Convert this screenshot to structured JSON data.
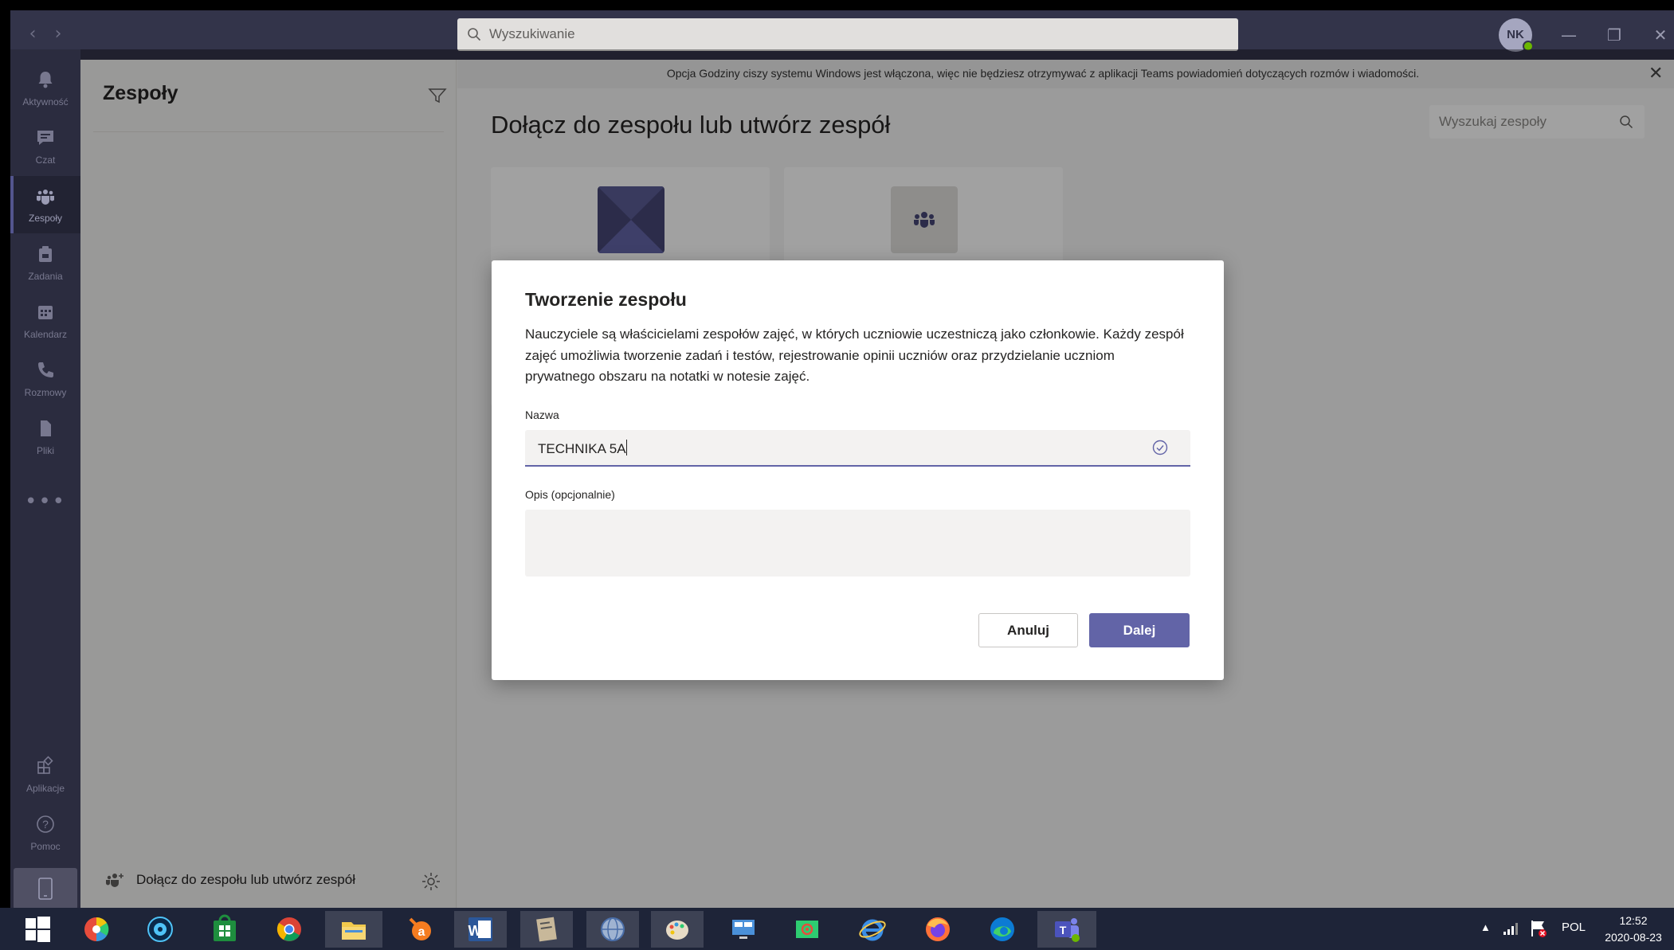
{
  "titlebar": {
    "search_placeholder": "Wyszukiwanie",
    "avatar_initials": "NK",
    "minimize": "—",
    "restore": "❐",
    "close": "✕"
  },
  "rail": {
    "items": [
      {
        "label": "Aktywność",
        "icon": "bell-icon"
      },
      {
        "label": "Czat",
        "icon": "chat-icon"
      },
      {
        "label": "Zespoły",
        "icon": "teams-icon"
      },
      {
        "label": "Zadania",
        "icon": "assignments-icon"
      },
      {
        "label": "Kalendarz",
        "icon": "calendar-icon"
      },
      {
        "label": "Rozmowy",
        "icon": "phone-icon"
      },
      {
        "label": "Pliki",
        "icon": "files-icon"
      }
    ],
    "more": "•••",
    "apps_label": "Aplikacje",
    "help_label": "Pomoc"
  },
  "teams_panel": {
    "title": "Zespoły",
    "join_label": "Dołącz do zespołu lub utwórz zespół"
  },
  "main": {
    "banner": "Opcja Godziny ciszy systemu Windows jest włączona, więc nie będziesz otrzymywać z aplikacji Teams powiadomień dotyczących rozmów i wiadomości.",
    "banner_close": "✕",
    "heading": "Dołącz do zespołu lub utwórz zespół",
    "team_search_placeholder": "Wyszukaj zespoły"
  },
  "dialog": {
    "title": "Tworzenie zespołu",
    "description": "Nauczyciele są właścicielami zespołów zajęć, w których uczniowie uczestniczą jako członkowie. Każdy zespół zajęć umożliwia tworzenie zadań i testów, rejestrowanie opinii uczniów oraz przydzielanie uczniom prywatnego obszaru na notatki w notesie zajęć.",
    "name_label": "Nazwa",
    "name_value": "TECHNIKA 5A",
    "desc_label": "Opis (opcjonalnie)",
    "cancel": "Anuluj",
    "next": "Dalej"
  },
  "taskbar": {
    "tray_language": "POL",
    "time": "12:52",
    "date": "2020-08-23"
  },
  "colors": {
    "accent": "#6264a7",
    "titlebar": "#33344a",
    "taskbar": "#1e2438"
  }
}
